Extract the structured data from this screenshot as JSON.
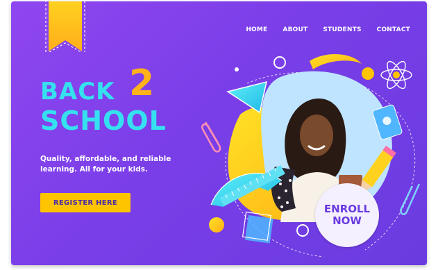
{
  "nav": {
    "items": [
      "HOME",
      "ABOUT",
      "STUDENTS",
      "CONTACT"
    ]
  },
  "hero": {
    "line1": "BACK",
    "numeral": "2",
    "line2": "SCHOOL",
    "tagline_line1": "Quality, affordable, and reliable",
    "tagline_line2": "learning. All for your kids."
  },
  "buttons": {
    "register": "REGISTER HERE",
    "enroll_line1": "ENROLL",
    "enroll_line2": "NOW"
  },
  "icons": [
    "bookmark-ribbon-icon",
    "triangle-ruler-icon",
    "atom-icon",
    "paperclip-icon",
    "pencil-icon",
    "sharpener-icon",
    "protractor-icon",
    "ruler-icon",
    "square-shape-icon"
  ],
  "colors": {
    "background_start": "#8f46f0",
    "background_end": "#6a3be0",
    "accent_cyan": "#35e1ef",
    "accent_yellow": "#ffc400",
    "accent_orange": "#ffb21a",
    "white": "#ffffff"
  }
}
